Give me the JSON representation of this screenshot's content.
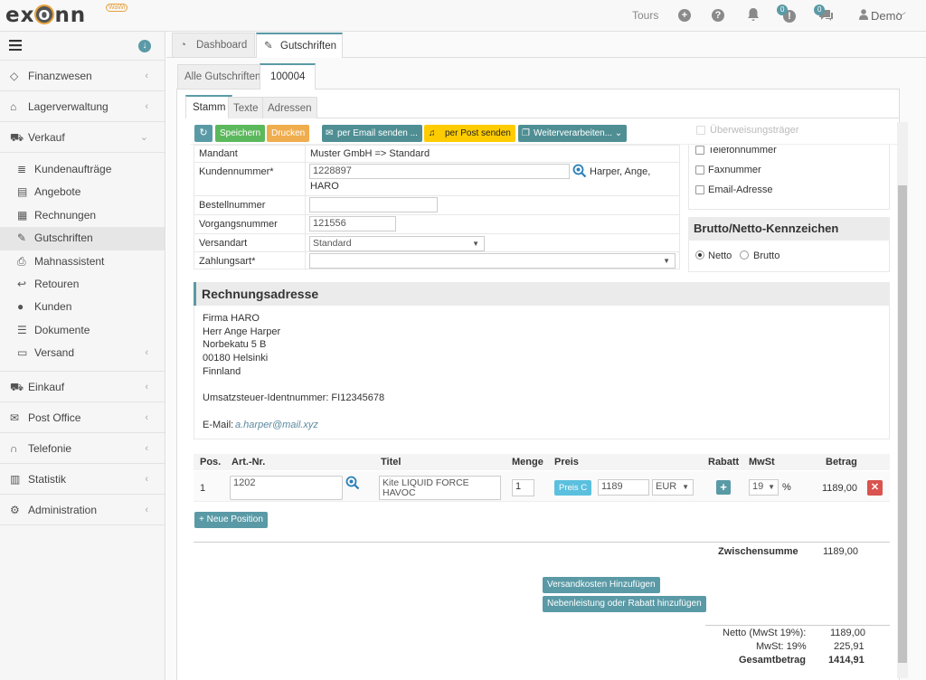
{
  "app": {
    "logo": "ex",
    "logo_o": "O",
    "logo_tail": "nn",
    "logo_badge": "WaWi"
  },
  "topbar": {
    "tours": "Tours",
    "badge_1": "0",
    "badge_2": "0",
    "user": "Demo"
  },
  "sidebar": {
    "items": [
      {
        "label": "Finanzwesen"
      },
      {
        "label": "Lagerverwaltung"
      },
      {
        "label": "Verkauf"
      },
      {
        "label": "Einkauf"
      },
      {
        "label": "Post Office"
      },
      {
        "label": "Telefonie"
      },
      {
        "label": "Statistik"
      },
      {
        "label": "Administration"
      }
    ],
    "verkauf_sub": [
      {
        "label": "Kundenaufträge"
      },
      {
        "label": "Angebote"
      },
      {
        "label": "Rechnungen"
      },
      {
        "label": "Gutschriften"
      },
      {
        "label": "Mahnassistent"
      },
      {
        "label": "Retouren"
      },
      {
        "label": "Kunden"
      },
      {
        "label": "Dokumente"
      },
      {
        "label": "Versand"
      }
    ]
  },
  "tabs": {
    "main": [
      "Dashboard",
      "Gutschriften"
    ],
    "sub": [
      "Alle Gutschriften",
      "100004"
    ],
    "inner": [
      "Stamm",
      "Texte",
      "Adressen"
    ]
  },
  "toolbar": {
    "save": "Speichern",
    "print": "Drucken",
    "email": "per Email senden ...",
    "post": "per Post senden",
    "process": "Weiterverarbeiten..."
  },
  "form": {
    "mandant_label": "Mandant",
    "mandant_value": "Muster GmbH => Standard",
    "kundennr_label": "Kundennummer*",
    "kundennr_value": "1228897",
    "kunde_name": "Harper, Ange,",
    "kunde_firma": "HARO",
    "bestellnr_label": "Bestellnummer",
    "bestellnr_value": "",
    "vorgangsnr_label": "Vorgangsnummer",
    "vorgangsnr_value": "121556",
    "versandart_label": "Versandart",
    "versandart_value": "Standard",
    "zahlungsart_label": "Zahlungsart*",
    "zahlungsart_value": ""
  },
  "right_checks": [
    "Überweisungsträger",
    "Telefonnummer",
    "Faxnummer",
    "Email-Adresse"
  ],
  "brutto_netto": {
    "title": "Brutto/Netto-Kennzeichen",
    "netto": "Netto",
    "brutto": "Brutto",
    "selected": "Netto"
  },
  "rechnungsadresse": {
    "title": "Rechnungsadresse",
    "lines": [
      "Firma HARO",
      "Herr Ange Harper",
      "Norbekatu 5 B",
      "00180 Helsinki",
      "Finnland"
    ],
    "ust": "Umsatzsteuer-Identnummer: FI12345678",
    "email_label": "E-Mail:",
    "email": "a.harper@mail.xyz"
  },
  "positions": {
    "headers": [
      "Pos.",
      "Art.-Nr.",
      "Titel",
      "Menge",
      "Preis",
      "Rabatt",
      "MwSt",
      "Betrag"
    ],
    "rows": [
      {
        "pos": "1",
        "artnr": "1202",
        "titel": "Kite LIQUID FORCE HAVOC",
        "menge": "1",
        "preis_btn": "Preis C",
        "preis": "1189",
        "currency": "EUR",
        "mwst": "19",
        "percent": "%",
        "betrag": "1189,00"
      }
    ],
    "new_position": "+ Neue Position"
  },
  "summary": {
    "zwischensumme_label": "Zwischensumme",
    "zwischensumme": "1189,00",
    "versand_btn": "Versandkosten Hinzufügen",
    "neben_btn": "Nebenleistung oder Rabatt hinzufügen",
    "netto_label": "Netto (MwSt 19%):",
    "netto": "1189,00",
    "mwst_label": "MwSt: 19%",
    "mwst": "225,91",
    "gesamt_label": "Gesamtbetrag",
    "gesamt": "1414,91"
  },
  "colors": {
    "accent": "#5a9aa6",
    "save": "#5cb85c",
    "print": "#f0ad4e",
    "post": "#fecc00",
    "danger": "#d9534f"
  }
}
